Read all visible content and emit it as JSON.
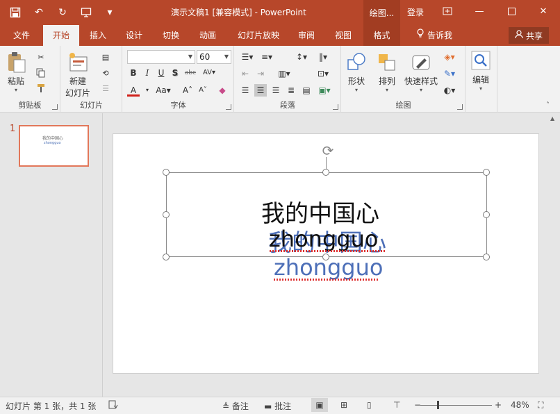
{
  "titlebar": {
    "title": "演示文稿1 [兼容模式] - PowerPoint",
    "context_title": "绘图...",
    "login": "登录"
  },
  "tabs": [
    {
      "label": "文件"
    },
    {
      "label": "开始"
    },
    {
      "label": "插入"
    },
    {
      "label": "设计"
    },
    {
      "label": "切换"
    },
    {
      "label": "动画"
    },
    {
      "label": "幻灯片放映"
    },
    {
      "label": "审阅"
    },
    {
      "label": "视图"
    },
    {
      "label": "格式"
    }
  ],
  "tell_me": "告诉我",
  "share": "共享",
  "ribbon": {
    "clipboard": {
      "paste": "粘贴",
      "label": "剪贴板"
    },
    "slides": {
      "new_slide_line1": "新建",
      "new_slide_line2": "幻灯片",
      "label": "幻灯片"
    },
    "font": {
      "font_name": "",
      "font_size": "60",
      "label": "字体"
    },
    "paragraph": {
      "label": "段落"
    },
    "drawing": {
      "shapes": "形状",
      "arrange": "排列",
      "quick_styles": "快速样式",
      "label": "绘图"
    },
    "editing": {
      "edit": "编辑"
    }
  },
  "thumbnail": {
    "number": "1",
    "line1": "我的中国心",
    "line2": "zhongguo"
  },
  "slide": {
    "main_text": "我的中国心",
    "blue_cn": "我的中国心",
    "black_pinyin": "zhongguo",
    "blue_pinyin": "zhongguo"
  },
  "status": {
    "slide_info": "幻灯片 第 1 张，共 1 张",
    "notes": "备注",
    "comments": "批注",
    "zoom": "48%"
  },
  "colors": {
    "accent": "#b7472a",
    "blue_text": "#4d6fb8"
  }
}
